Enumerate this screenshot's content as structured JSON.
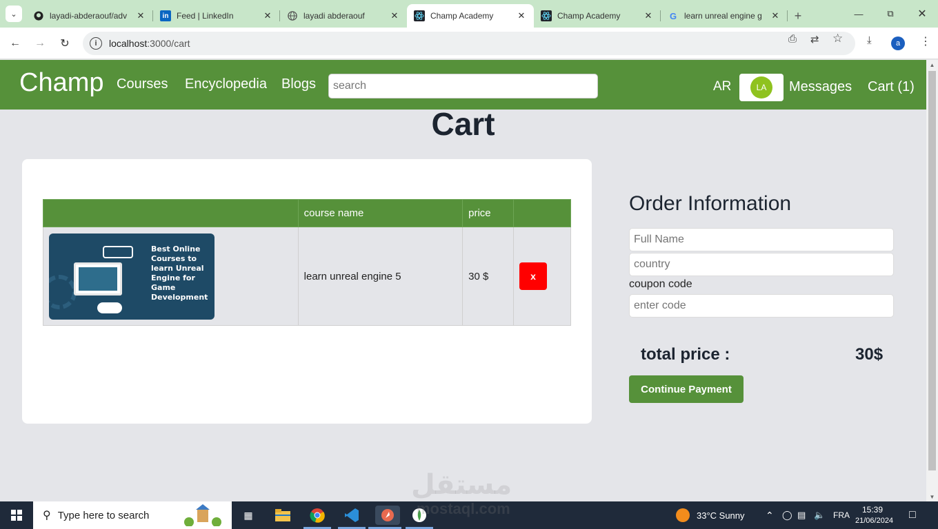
{
  "browser": {
    "tabs": [
      {
        "title": "layadi-abderaouf/adv",
        "icon": "github-icon"
      },
      {
        "title": "Feed | LinkedIn",
        "icon": "linkedin-icon"
      },
      {
        "title": "layadi abderaouf",
        "icon": "globe-icon"
      },
      {
        "title": "Champ Academy",
        "icon": "react-icon",
        "active": true
      },
      {
        "title": "Champ Academy",
        "icon": "react-icon"
      },
      {
        "title": "learn unreal engine g",
        "icon": "google-icon"
      }
    ],
    "url_host": "localhost",
    "url_rest": ":3000/cart",
    "profile_initial": "a"
  },
  "navbar": {
    "brand": "Champ",
    "links": [
      "Courses",
      "Encyclopedia",
      "Blogs"
    ],
    "search_placeholder": "search",
    "lang": "AR",
    "avatar_initials": "LA",
    "messages": "Messages",
    "cart": "Cart (1)"
  },
  "page": {
    "title": "Cart"
  },
  "cart": {
    "headers": [
      "",
      "course name",
      "price",
      ""
    ],
    "items": [
      {
        "image_text": "Best Online Courses to learn Unreal Engine for Game Development",
        "name": "learn unreal engine 5",
        "price": "30 $",
        "remove": "x"
      }
    ]
  },
  "order": {
    "title": "Order Information",
    "full_name_placeholder": "Full Name",
    "country_placeholder": "country",
    "coupon_label": "coupon code",
    "coupon_placeholder": "enter code",
    "total_label": "total price :",
    "total_value": "30$",
    "pay_button": "Continue Payment"
  },
  "watermark": {
    "arabic": "مستقل",
    "latin": "mostaql.com"
  },
  "taskbar": {
    "search_placeholder": "Type here to search",
    "weather": "33°C  Sunny",
    "lang": "FRA",
    "time": "15:39",
    "date": "21/06/2024"
  },
  "colors": {
    "brand_green": "#56913a",
    "remove_red": "#ff0000",
    "avatar_green": "#8fc21f"
  }
}
